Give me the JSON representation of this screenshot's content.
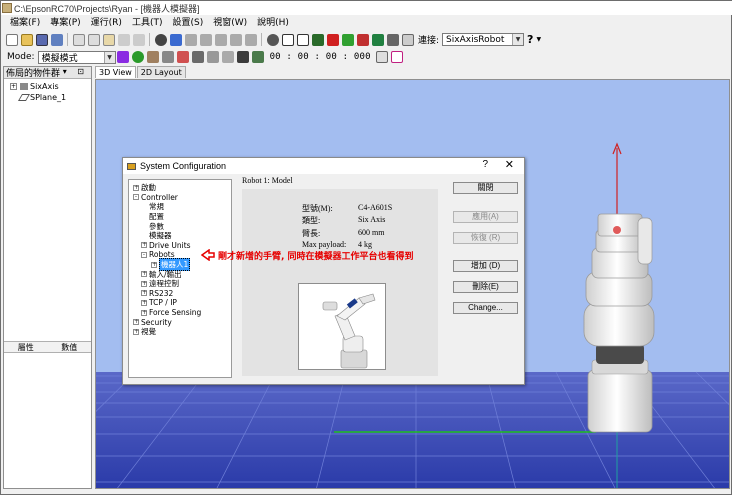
{
  "window": {
    "title": "C:\\EpsonRC70\\Projects\\Ryan - [機器人模擬器]"
  },
  "menu": [
    "檔案(F)",
    "專案(P)",
    "運行(R)",
    "工具(T)",
    "設置(S)",
    "視窗(W)",
    "說明(H)"
  ],
  "toolbar": {
    "connection_label": "連接:",
    "connection_value": "SixAxisRobot",
    "help_label": "?"
  },
  "toolbar2": {
    "mode_label": "Mode:",
    "mode_value": "模擬模式",
    "time": "00 : 00 : 00 : 000"
  },
  "layout_panel": {
    "title": "佈局的物件群",
    "pin": "▾ ⊡",
    "items": [
      {
        "label": "SixAxis",
        "expandable": true
      },
      {
        "label": "SPlane_1",
        "expandable": false
      }
    ],
    "bottom_tabs": [
      "屬性",
      "數值"
    ]
  },
  "view_tabs": [
    "3D View",
    "2D Layout"
  ],
  "dialog": {
    "title": "System Configuration",
    "help": "?",
    "close": "✕",
    "tree": [
      {
        "label": "啟動",
        "level": 0,
        "toggle": "+"
      },
      {
        "label": "Controller",
        "level": 0,
        "toggle": "-"
      },
      {
        "label": "常規",
        "level": 1,
        "toggle": ""
      },
      {
        "label": "配置",
        "level": 1,
        "toggle": ""
      },
      {
        "label": "參數",
        "level": 1,
        "toggle": ""
      },
      {
        "label": "模擬器",
        "level": 1,
        "toggle": ""
      },
      {
        "label": "Drive Units",
        "level": 1,
        "toggle": "+"
      },
      {
        "label": "Robots",
        "level": 1,
        "toggle": "-"
      },
      {
        "label": "機器人1",
        "level": 2,
        "toggle": "+",
        "selected": true
      },
      {
        "label": "輸入/輸出",
        "level": 1,
        "toggle": "+"
      },
      {
        "label": "遠程控制",
        "level": 1,
        "toggle": "+"
      },
      {
        "label": "RS232",
        "level": 1,
        "toggle": "+"
      },
      {
        "label": "TCP / IP",
        "level": 1,
        "toggle": "+"
      },
      {
        "label": "Force Sensing",
        "level": 1,
        "toggle": "+"
      },
      {
        "label": "Security",
        "level": 0,
        "toggle": "+"
      },
      {
        "label": "視覺",
        "level": 0,
        "toggle": "+"
      }
    ],
    "section_title": "Robot 1: Model",
    "specs": [
      {
        "key": "型號(M):",
        "value": "C4-A601S"
      },
      {
        "key": "類型:",
        "value": "Six Axis"
      },
      {
        "key": "臂長:",
        "value": "600 mm"
      },
      {
        "key": "Max payload:",
        "value": "4 kg"
      }
    ],
    "buttons": [
      {
        "label": "關閉",
        "disabled": false
      },
      {
        "label": "應用(A)",
        "disabled": true
      },
      {
        "label": "恢復 (R)",
        "disabled": true
      },
      {
        "label": "增加 (D)",
        "disabled": false
      },
      {
        "label": "刪除(E)",
        "disabled": false
      },
      {
        "label": "Change...",
        "disabled": false
      }
    ]
  },
  "annotation": "剛才新增的手臂, 同時在模擬器工作平台也看得到",
  "colors": {
    "sky": "#a3bdf0",
    "floor": "#3a4cb0",
    "annotation": "#e60000",
    "selection": "#3399ff"
  }
}
